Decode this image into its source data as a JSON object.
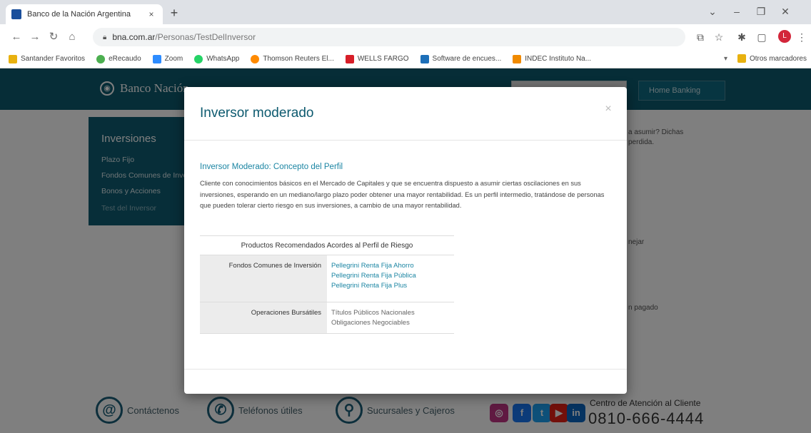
{
  "browser": {
    "tab_title": "Banco de la Nación Argentina",
    "tab_close": "×",
    "new_tab": "+",
    "url_host": "bna.com.ar",
    "url_path": "/Personas/TestDelInversor",
    "bookmarks": [
      {
        "label": "Santander Favoritos",
        "color": "#e8b10f"
      },
      {
        "label": "eRecaudo",
        "color": "#4caf50"
      },
      {
        "label": "Zoom",
        "color": "#2d8cff"
      },
      {
        "label": "WhatsApp",
        "color": "#25d366"
      },
      {
        "label": "Thomson Reuters El...",
        "color": "#ff8a00"
      },
      {
        "label": "WELLS FARGO",
        "color": "#d71e28"
      },
      {
        "label": "Software de encues...",
        "color": "#1d6fb8"
      },
      {
        "label": "INDEC Instituto Na...",
        "color": "#f08a00"
      }
    ],
    "other_bookmarks": "Otros marcadores"
  },
  "site": {
    "logo_text": "Banco Nación",
    "home_banking": "Home Banking",
    "sidebar": {
      "title": "Inversiones",
      "items": [
        "Plazo Fijo",
        "Fondos Comunes de Inversión",
        "Bonos y Acciones",
        "Test del Inversor"
      ]
    },
    "behind_texts": [
      "a asumir? Dichas",
      "perdida.",
      "nejar",
      "n pagado"
    ],
    "footer": {
      "contact": "Contáctenos",
      "phones": "Teléfonos útiles",
      "branches": "Sucursales y Cajeros",
      "cac_label": "Centro de Atención al Cliente",
      "cac_phone": "0810-666-4444"
    }
  },
  "modal": {
    "title": "Inversor moderado",
    "close": "×",
    "section_title": "Inversor Moderado: Concepto del Perfil",
    "description": "Cliente con conocimientos básicos en el Mercado de Capitales y que se encuentra dispuesto a asumir ciertas oscilaciones en sus inversiones, esperando en un mediano/largo plazo poder obtener una mayor rentabilidad. Es un perfil intermedio, tratándose de personas que pueden tolerar cierto riesgo en sus inversiones, a cambio de una mayor rentabilidad.",
    "table_header": "Productos Recomendados Acordes al Perfil de Riesgo",
    "rows": [
      {
        "label": "Fondos Comunes de Inversión",
        "items": [
          "Pellegrini Renta Fija Ahorro",
          "Pellegrini Renta Fija Pública",
          "Pellegrini Renta Fija Plus"
        ]
      },
      {
        "label": "Operaciones Bursátiles",
        "items": [
          "Títulos Públicos Nacionales",
          "Obligaciones Negociables"
        ]
      }
    ]
  }
}
